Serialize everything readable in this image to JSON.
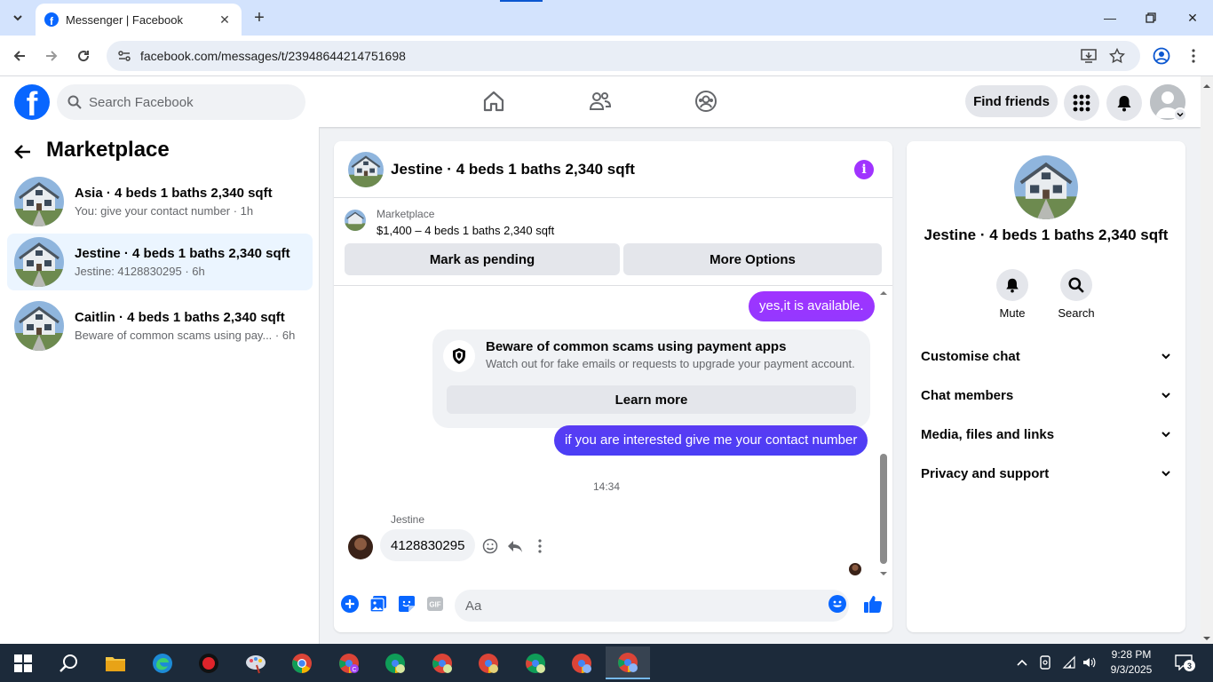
{
  "browser": {
    "tab_title": "Messenger | Facebook",
    "url": "facebook.com/messages/t/23948644214751698"
  },
  "header": {
    "search_placeholder": "Search Facebook",
    "find_friends": "Find friends"
  },
  "sidebar": {
    "title": "Marketplace",
    "conversations": [
      {
        "name": "Asia · 4 beds 1 baths 2,340 sqft",
        "preview": "You: give your contact number · 1h",
        "active": false
      },
      {
        "name": "Jestine · 4 beds 1 baths 2,340 sqft",
        "preview": "Jestine: 4128830295 · 6h",
        "active": true
      },
      {
        "name": "Caitlin · 4 beds 1 baths 2,340 sqft",
        "preview": "Beware of common scams using pay...  · 6h",
        "active": false
      }
    ]
  },
  "chat": {
    "title": "Jestine · 4 beds 1 baths 2,340 sqft",
    "marketplace_label": "Marketplace",
    "listing": "$1,400 – 4 beds 1 baths 2,340 sqft",
    "mark_pending": "Mark as pending",
    "more_options": "More Options",
    "messages": {
      "out1": "yes,it is available.",
      "scam_title": "Beware of common scams using payment apps",
      "scam_desc": "Watch out for fake emails or requests to upgrade your payment account.",
      "learn_more": "Learn more",
      "out2": "if you are interested give me your contact number",
      "timestamp": "14:34",
      "sender": "Jestine",
      "in1": "4128830295"
    },
    "composer_placeholder": "Aa"
  },
  "info_panel": {
    "name": "Jestine · 4 beds 1 baths 2,340 sqft",
    "mute": "Mute",
    "search": "Search",
    "rows": [
      "Customise chat",
      "Chat members",
      "Media, files and links",
      "Privacy and support"
    ]
  },
  "taskbar": {
    "time": "9:28 PM",
    "date": "9/3/2025",
    "notifications": "3"
  },
  "colors": {
    "fb_blue": "#0866ff",
    "accent_purple": "#a033ff",
    "bubble_gradient_top": "#a033ff",
    "bubble_gradient_bottom": "#4a3ef5"
  }
}
